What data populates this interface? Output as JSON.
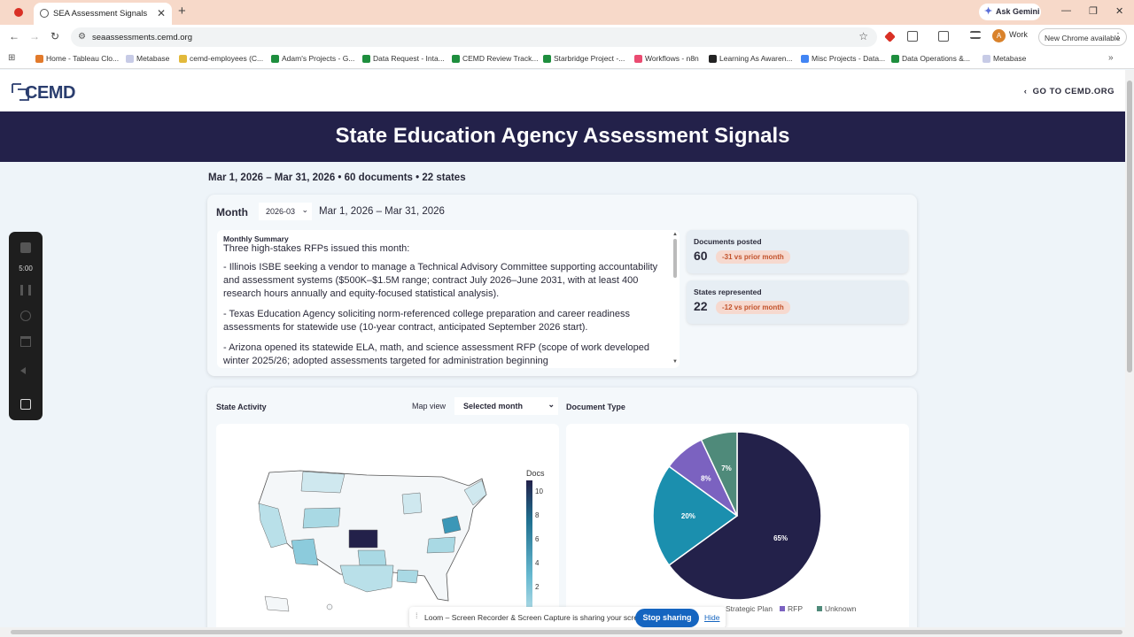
{
  "browser": {
    "tab_title": "SEA Assessment Signals",
    "url": "seaassessments.cemd.org",
    "ask_gemini": "Ask Gemini",
    "profile_initial": "A",
    "profile_name": "Work",
    "new_chrome": "New Chrome available",
    "bookmarks": [
      "Home - Tableau Clo...",
      "Metabase",
      "cemd-employees (C...",
      "Adam's Projects - G...",
      "Data Request - Inta...",
      "CEMD Review Track...",
      "Starbridge Project -...",
      "Workflows - n8n",
      "Learning As Awaren...",
      "Misc Projects - Data...",
      "Data Operations &...",
      "Metabase"
    ]
  },
  "site": {
    "logo_text": "CEMD",
    "goto_link": "GO TO CEMD.ORG",
    "page_title": "State Education Agency Assessment Signals",
    "subline": "Mar 1, 2026 – Mar 31, 2026 • 60 documents • 22 states"
  },
  "month_card": {
    "label": "Month",
    "selected_month": "2026-03",
    "range": "Mar 1, 2026 – Mar 31, 2026",
    "summary_title": "Monthly Summary",
    "summary_intro": "Three high-stakes RFPs issued this month:",
    "summary_items": [
      "- Illinois ISBE seeking a vendor to manage a Technical Advisory Committee supporting accountability and assessment systems ($500K–$1.5M range; contract July 2026–June 2031, with at least 400 research hours annually and equity-focused statistical analysis).",
      "- Texas Education Agency soliciting norm-referenced college preparation and career readiness assessments for statewide use (10-year contract, anticipated September 2026 start).",
      "- Arizona opened its statewide ELA, math, and science assessment RFP (scope of work developed winter 2025/26; adopted assessments targeted for administration beginning"
    ],
    "stats": [
      {
        "label": "Documents posted",
        "value": "60",
        "delta": "-31 vs prior month"
      },
      {
        "label": "States represented",
        "value": "22",
        "delta": "-12 vs prior month"
      }
    ]
  },
  "activity": {
    "state_activity_label": "State Activity",
    "map_view_label": "Map view",
    "map_view_selected": "Selected month",
    "doc_type_label": "Document Type",
    "legend_title": "Docs",
    "legend_ticks": [
      "10",
      "8",
      "6",
      "4",
      "2"
    ],
    "pie_legend_visible": [
      "Strategic Plan",
      "RFP",
      "Unknown"
    ]
  },
  "chart_data": {
    "type": "pie",
    "title": "Document Type",
    "slices": [
      {
        "label": "",
        "value": 65,
        "color": "#23214a"
      },
      {
        "label": "",
        "value": 20,
        "color": "#1b8fae"
      },
      {
        "label": "RFP",
        "value": 8,
        "color": "#7b62c0"
      },
      {
        "label": "Unknown",
        "value": 7,
        "color": "#4f8a7a"
      }
    ],
    "value_labels": [
      "65%",
      "20%",
      "8%",
      "7%"
    ],
    "legend_visible": [
      "Strategic Plan",
      "RFP",
      "Unknown"
    ]
  },
  "recorder": {
    "time": "5:00"
  },
  "loom": {
    "message": "Loom – Screen Recorder & Screen Capture is sharing your screen.",
    "stop_label": "Stop sharing",
    "hide_label": "Hide"
  },
  "colors": {
    "banner": "#23214a",
    "accent": "#2a3d6e",
    "delta_bg": "#f6d9cf",
    "delta_text": "#c2522b"
  }
}
